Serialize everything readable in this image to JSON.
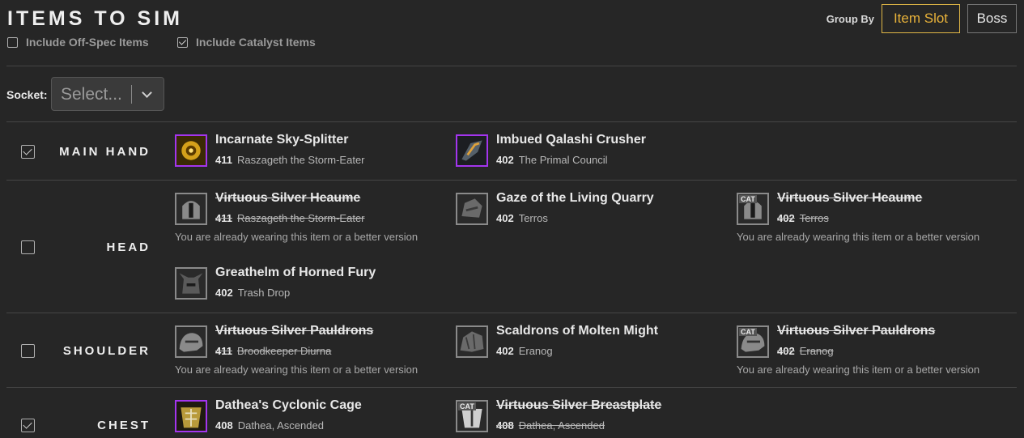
{
  "header": {
    "title": "ITEMS TO SIM",
    "off_spec_label": "Include Off-Spec Items",
    "catalyst_label": "Include Catalyst Items",
    "group_by_label": "Group By",
    "item_slot_label": "Item Slot",
    "boss_label": "Boss"
  },
  "socket": {
    "label": "Socket:",
    "placeholder": "Select..."
  },
  "slots": [
    {
      "label": "MAIN HAND",
      "checked": true,
      "items": [
        {
          "name": "Incarnate Sky-Splitter",
          "ilvl": "411",
          "source": "Raszageth the Storm-Eater",
          "icon": "mace-icon"
        },
        {
          "name": "Imbued Qalashi Crusher",
          "ilvl": "402",
          "source": "The Primal Council",
          "icon": "mace-icon"
        }
      ]
    },
    {
      "label": "HEAD",
      "checked": false,
      "items": [
        {
          "name": "Virtuous Silver Heaume",
          "ilvl": "411",
          "source": "Raszageth the Storm-Eater",
          "note": "You are already wearing this item or a better version",
          "icon": "helm-icon"
        },
        {
          "name": "Gaze of the Living Quarry",
          "ilvl": "402",
          "source": "Terros",
          "icon": "helm-icon"
        },
        {
          "name": "Virtuous Silver Heaume",
          "ilvl": "402",
          "source": "Terros",
          "note": "You are already wearing this item or a better version",
          "badge": "CAT",
          "icon": "helm-icon"
        },
        {
          "name": "Greathelm of Horned Fury",
          "ilvl": "402",
          "source": "Trash Drop",
          "icon": "helm-icon"
        }
      ]
    },
    {
      "label": "SHOULDER",
      "checked": false,
      "items": [
        {
          "name": "Virtuous Silver Pauldrons",
          "ilvl": "411",
          "source": "Broodkeeper Diurna",
          "note": "You are already wearing this item or a better version",
          "icon": "shoulder-icon"
        },
        {
          "name": "Scaldrons of Molten Might",
          "ilvl": "402",
          "source": "Eranog",
          "icon": "shoulder-icon"
        },
        {
          "name": "Virtuous Silver Pauldrons",
          "ilvl": "402",
          "source": "Eranog",
          "note": "You are already wearing this item or a better version",
          "badge": "CAT",
          "icon": "shoulder-icon"
        }
      ]
    },
    {
      "label": "CHEST",
      "checked": true,
      "items": [
        {
          "name": "Dathea's Cyclonic Cage",
          "ilvl": "408",
          "source": "Dathea, Ascended",
          "icon": "chest-icon"
        },
        {
          "name": "Virtuous Silver Breastplate",
          "ilvl": "408",
          "source": "Dathea, Ascended",
          "badge": "CAT",
          "icon": "chest-icon"
        }
      ]
    }
  ],
  "colors": {
    "accent": "#e8b23a",
    "epic_border": "#a335ee",
    "background": "#262626"
  }
}
